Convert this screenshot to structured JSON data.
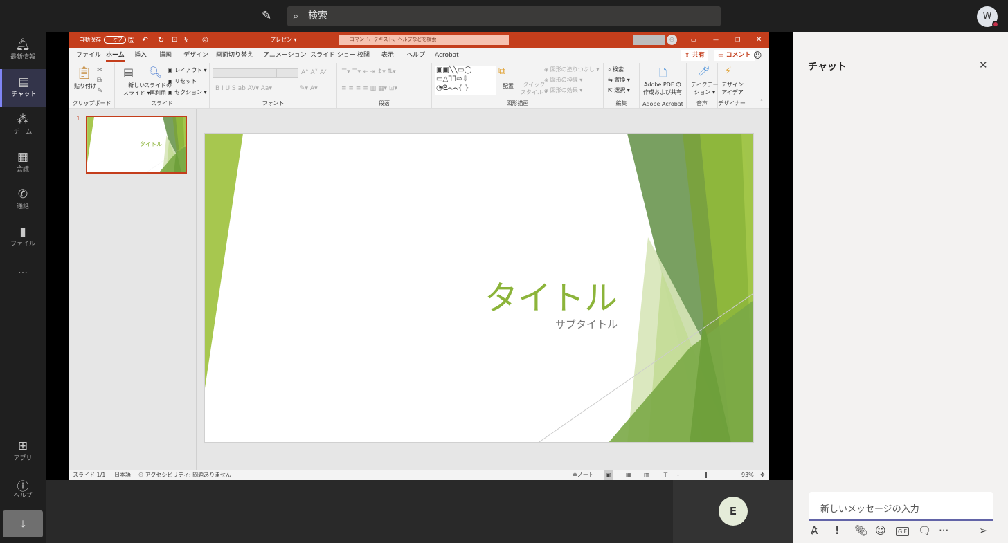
{
  "topbar": {
    "search_placeholder": "検索",
    "avatar": "W",
    "compose_icon": "compose-icon"
  },
  "rail": {
    "items": [
      {
        "label": "最新情報",
        "icon": "bell-icon"
      },
      {
        "label": "チャット",
        "icon": "chat-icon",
        "active": true
      },
      {
        "label": "チーム",
        "icon": "teams-icon"
      },
      {
        "label": "会議",
        "icon": "calendar-icon"
      },
      {
        "label": "通話",
        "icon": "phone-icon"
      },
      {
        "label": "ファイル",
        "icon": "file-icon"
      },
      {
        "label": "…",
        "icon": "more-icon"
      }
    ],
    "bottom": [
      {
        "label": "アプリ"
      },
      {
        "label": "ヘルプ"
      }
    ]
  },
  "participant": "E",
  "ppt": {
    "autosave": "自動保存",
    "autosave_state": "オフ",
    "filename": "プレゼン ▾",
    "search_placeholder": "コマンド、テキスト、ヘルプなどを検索",
    "tabs": [
      "ファイル",
      "ホーム",
      "挿入",
      "描画",
      "デザイン",
      "画面切り替え",
      "アニメーション",
      "スライド ショー",
      "校閲",
      "表示",
      "ヘルプ",
      "Acrobat"
    ],
    "share": "共有",
    "comment": "コメント",
    "ribbon": {
      "paste": "貼り付け",
      "clipboard": "クリップボード",
      "new_slide": [
        "新しい",
        "スライド ▾"
      ],
      "reuse": [
        "スライドの",
        "再利用"
      ],
      "layout": "レイアウト ▾",
      "reset": "リセット",
      "section": "セクション ▾",
      "slides": "スライド",
      "font_buttons": "B  I  U  S  ab  AV▾  Aa▾",
      "font": "フォント",
      "paragraph": "段落",
      "arrange": "配置",
      "quick_style": [
        "クイック",
        "スタイル ▾"
      ],
      "fill": "図形の塗りつぶし ▾",
      "outline": "図形の枠線 ▾",
      "effect": "図形の効果 ▾",
      "drawing": "図形描画",
      "find": "検索",
      "replace": "置換 ▾",
      "select": "選択 ▾",
      "editing": "編集",
      "adobe": [
        "Adobe PDF の",
        "作成および共有"
      ],
      "adobe_group": "Adobe Acrobat",
      "dictate": [
        "ディクテー",
        "ション ▾"
      ],
      "voice": "音声",
      "design_ideas": [
        "デザイン",
        "アイデア"
      ],
      "designer": "デザイナー"
    },
    "slide_number": "1",
    "slide": {
      "title": "タイトル",
      "subtitle": "サブタイトル"
    },
    "status": {
      "slide": "スライド 1/1",
      "language": "日本語",
      "accessibility": "アクセシビリティ: 問題ありません",
      "notes": "ノート",
      "zoom": "93%",
      "zoom_percent": 93
    }
  },
  "chat": {
    "title": "チャット",
    "input_placeholder": "新しいメッセージの入力"
  },
  "colors": {
    "accent": "#c43e1c",
    "teams": "#6264a7",
    "slide_green": "#8cb43a"
  }
}
